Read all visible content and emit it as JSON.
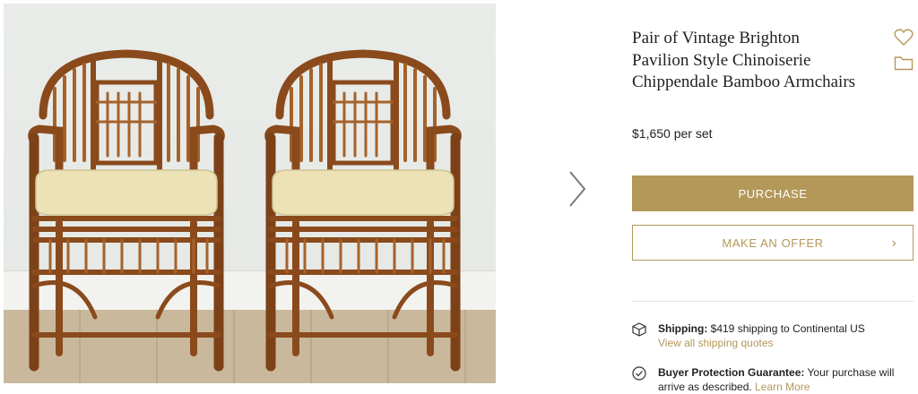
{
  "product": {
    "title": "Pair of Vintage Brighton Pavilion Style Chinoiserie Chippendale Bamboo Armchairs",
    "price": "$1,650 per set"
  },
  "icons": {
    "favorite": "heart-outline-icon",
    "collection": "folder-icon",
    "next": "chevron-right-icon",
    "shipping": "box-icon",
    "protection": "checkmark-circle-icon"
  },
  "actions": {
    "purchase_label": "PURCHASE",
    "offer_label": "MAKE AN OFFER"
  },
  "shipping": {
    "label": "Shipping:",
    "text": " $419 shipping to Continental US",
    "link": "View all shipping quotes"
  },
  "protection": {
    "label": "Buyer Protection Guarantee:",
    "text": " Your purchase will arrive as described.",
    "link": "Learn More"
  },
  "colors": {
    "accent": "#b4985a",
    "text": "#222222"
  }
}
